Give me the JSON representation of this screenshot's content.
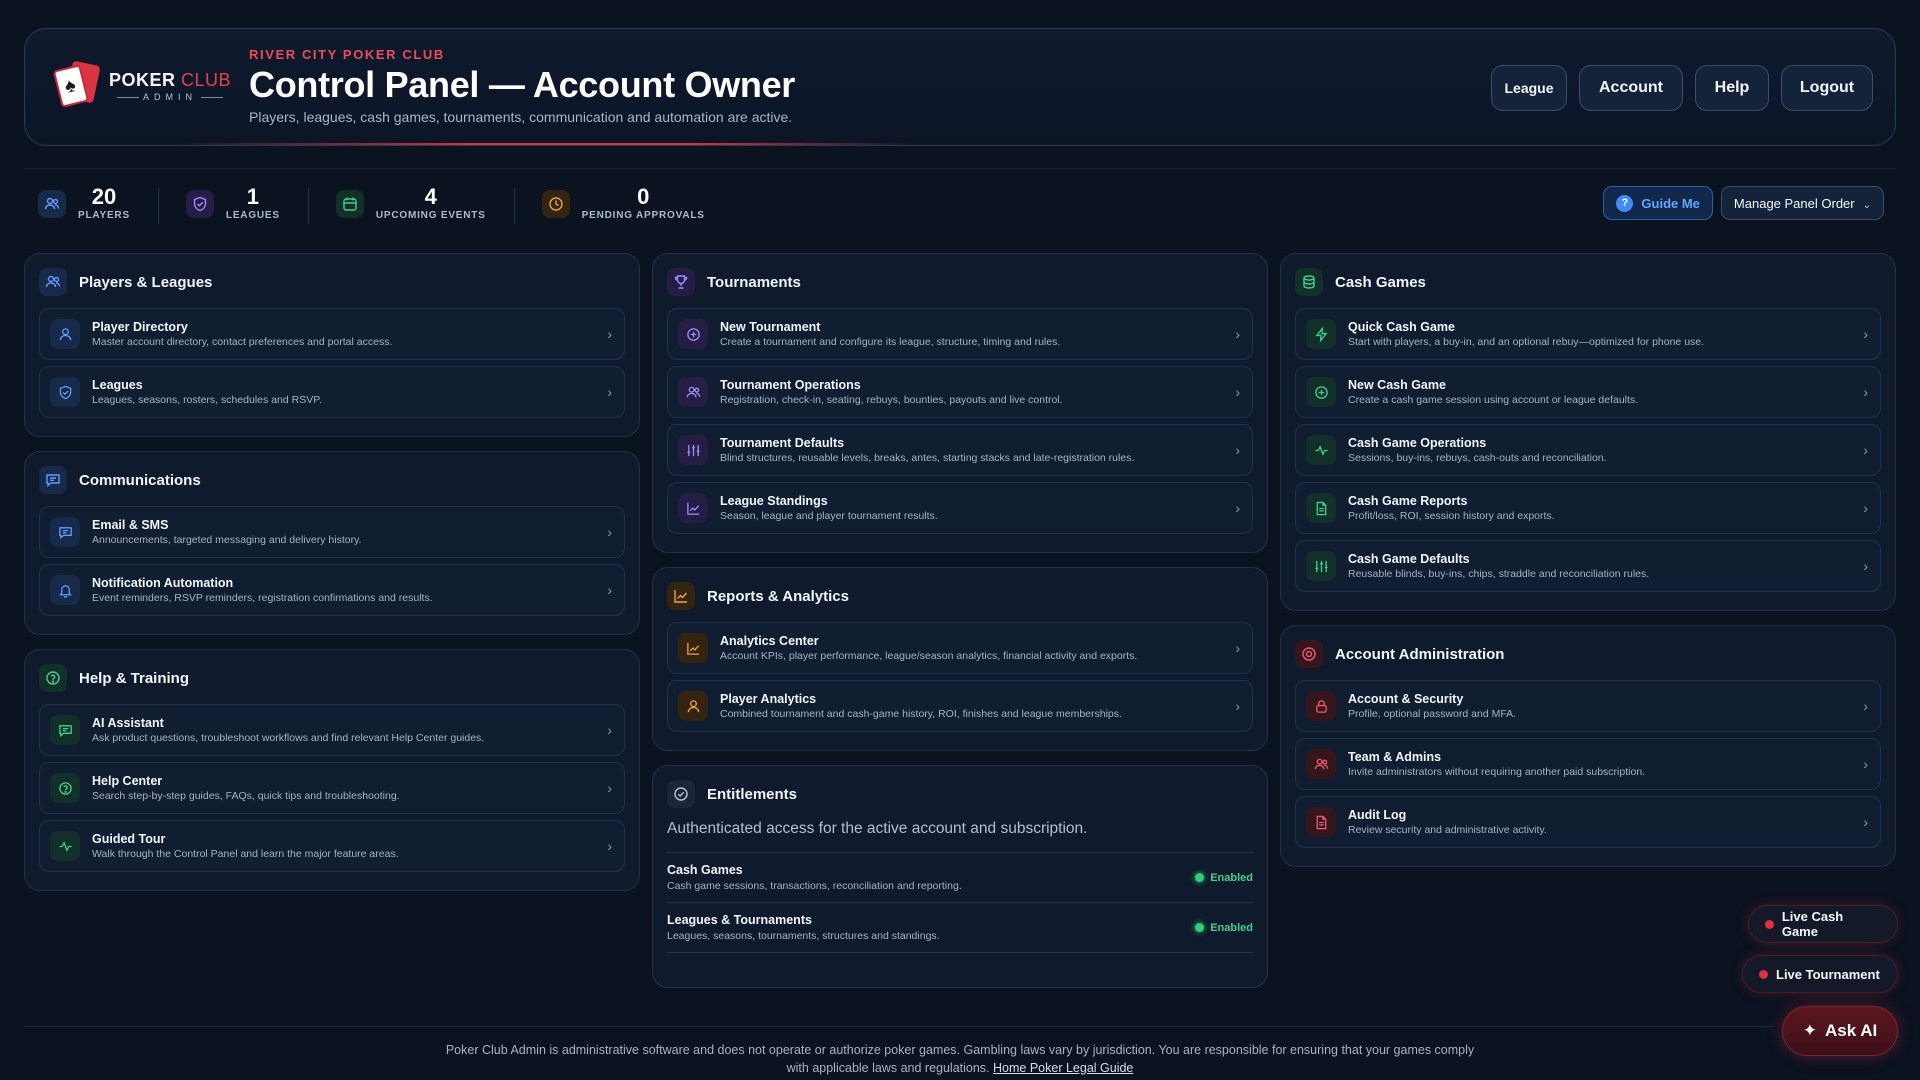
{
  "header": {
    "logo": {
      "brand": "POKER",
      "brand_accent": "CLUB",
      "sub": "ADMIN"
    },
    "club_name": "RIVER CITY POKER CLUB",
    "title": "Control Panel — Account Owner",
    "subtitle": "Players, leagues, cash games, tournaments, communication and automation are active.",
    "buttons": {
      "league": "League",
      "account": "Account",
      "help": "Help",
      "logout": "Logout"
    }
  },
  "stats": [
    {
      "value": "20",
      "label": "PLAYERS",
      "icon": "players-icon"
    },
    {
      "value": "1",
      "label": "LEAGUES",
      "icon": "shield-icon"
    },
    {
      "value": "4",
      "label": "UPCOMING EVENTS",
      "icon": "calendar-icon"
    },
    {
      "value": "0",
      "label": "PENDING APPROVALS",
      "icon": "clock-icon"
    }
  ],
  "toolbar": {
    "guide_me": "Guide Me",
    "manage_panel_order": "Manage Panel Order"
  },
  "players_leagues": {
    "title": "Players & Leagues",
    "items": [
      {
        "title": "Player Directory",
        "desc": "Master account directory, contact preferences and portal access."
      },
      {
        "title": "Leagues",
        "desc": "Leagues, seasons, rosters, schedules and RSVP."
      }
    ]
  },
  "communications": {
    "title": "Communications",
    "items": [
      {
        "title": "Email & SMS",
        "desc": "Announcements, targeted messaging and delivery history."
      },
      {
        "title": "Notification Automation",
        "desc": "Event reminders, RSVP reminders, registration confirmations and results."
      }
    ]
  },
  "help_training": {
    "title": "Help & Training",
    "items": [
      {
        "title": "AI Assistant",
        "desc": "Ask product questions, troubleshoot workflows and find relevant Help Center guides."
      },
      {
        "title": "Help Center",
        "desc": "Search step-by-step guides, FAQs, quick tips and troubleshooting."
      },
      {
        "title": "Guided Tour",
        "desc": "Walk through the Control Panel and learn the major feature areas."
      }
    ]
  },
  "tournaments": {
    "title": "Tournaments",
    "items": [
      {
        "title": "New Tournament",
        "desc": "Create a tournament and configure its league, structure, timing and rules."
      },
      {
        "title": "Tournament Operations",
        "desc": "Registration, check-in, seating, rebuys, bounties, payouts and live control."
      },
      {
        "title": "Tournament Defaults",
        "desc": "Blind structures, reusable levels, breaks, antes, starting stacks and late-registration rules."
      },
      {
        "title": "League Standings",
        "desc": "Season, league and player tournament results."
      }
    ]
  },
  "reports": {
    "title": "Reports & Analytics",
    "items": [
      {
        "title": "Analytics Center",
        "desc": "Account KPIs, player performance, league/season analytics, financial activity and exports."
      },
      {
        "title": "Player Analytics",
        "desc": "Combined tournament and cash-game history, ROI, finishes and league memberships."
      }
    ]
  },
  "entitlements": {
    "title": "Entitlements",
    "desc": "Authenticated access for the active account and subscription.",
    "rows": [
      {
        "title": "Cash Games",
        "desc": "Cash game sessions, transactions, reconciliation and reporting.",
        "status": "Enabled"
      },
      {
        "title": "Leagues & Tournaments",
        "desc": "Leagues, seasons, tournaments, structures and standings.",
        "status": "Enabled"
      }
    ]
  },
  "cash_games": {
    "title": "Cash Games",
    "items": [
      {
        "title": "Quick Cash Game",
        "desc": "Start with players, a buy-in, and an optional rebuy—optimized for phone use."
      },
      {
        "title": "New Cash Game",
        "desc": "Create a cash game session using account or league defaults."
      },
      {
        "title": "Cash Game Operations",
        "desc": "Sessions, buy-ins, rebuys, cash-outs and reconciliation."
      },
      {
        "title": "Cash Game Reports",
        "desc": "Profit/loss, ROI, session history and exports."
      },
      {
        "title": "Cash Game Defaults",
        "desc": "Reusable blinds, buy-ins, chips, straddle and reconciliation rules."
      }
    ]
  },
  "account_admin": {
    "title": "Account Administration",
    "items": [
      {
        "title": "Account & Security",
        "desc": "Profile, optional password and MFA."
      },
      {
        "title": "Team & Admins",
        "desc": "Invite administrators without requiring another paid subscription."
      },
      {
        "title": "Audit Log",
        "desc": "Review security and administrative activity."
      }
    ]
  },
  "floating": {
    "live_cash_game": "Live Cash Game",
    "live_tournament": "Live Tournament",
    "ask_ai": "Ask AI"
  },
  "footer": {
    "text": "Poker Club Admin is administrative software and does not operate or authorize poker games. Gambling laws vary by jurisdiction. You are responsible for ensuring that your games comply with applicable laws and regulations.",
    "link": "Home Poker Legal Guide"
  }
}
